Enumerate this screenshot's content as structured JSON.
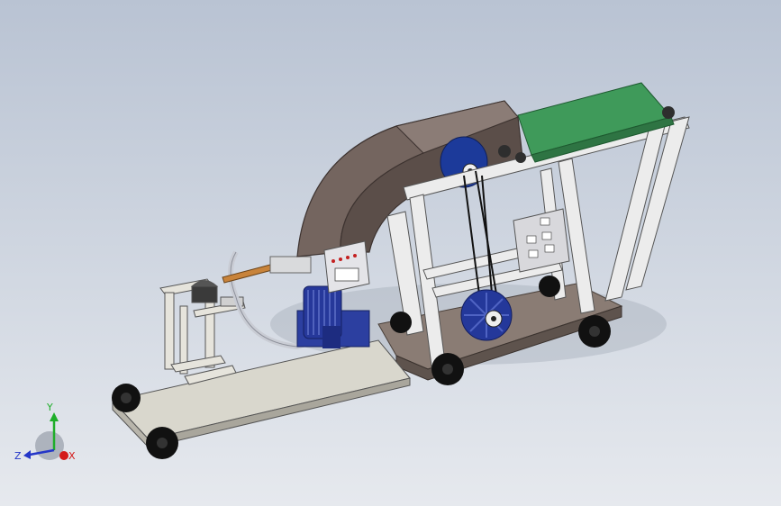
{
  "triad": {
    "axis_y": "Y",
    "axis_z": "Z",
    "axis_x": "X",
    "color_y": "#1fae2a",
    "color_z": "#2436c8",
    "color_x": "#d41a1a"
  },
  "colors": {
    "frame": "#e8e8e8",
    "hood": "#6e5f5a",
    "conveyor_belt": "#3f9a5a",
    "motor": "#26389a",
    "base_platform": "#8a7c74",
    "wheel": "#111111"
  }
}
